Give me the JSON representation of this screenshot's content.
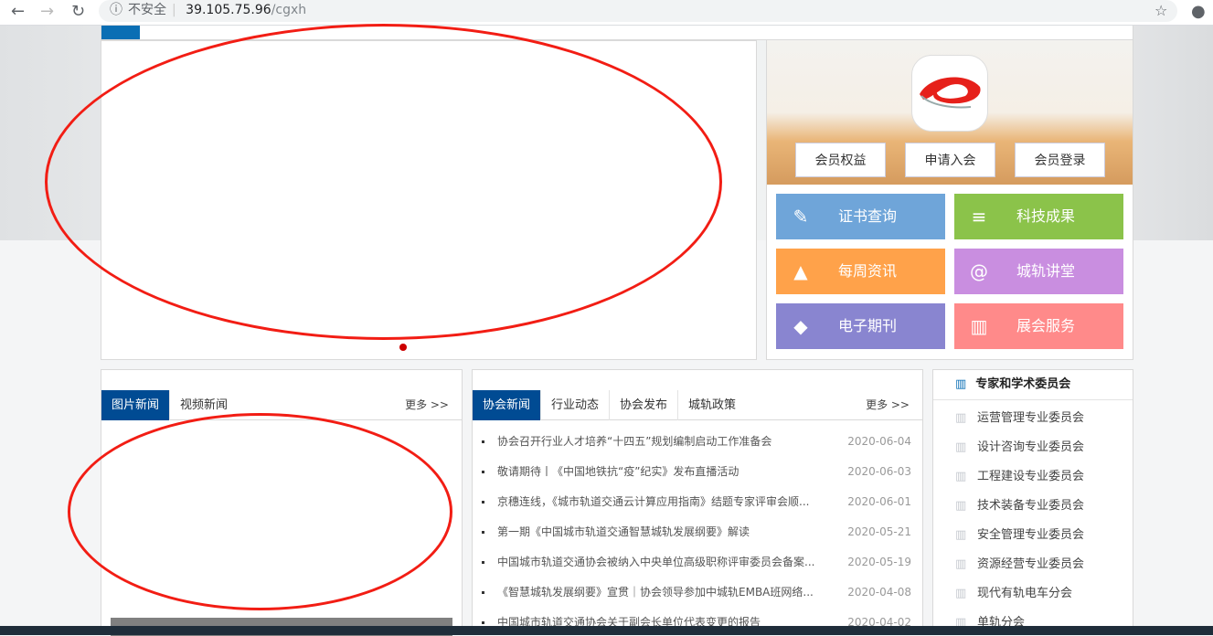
{
  "browser": {
    "back": "←",
    "forward": "→",
    "reload": "↻",
    "info": "ⓘ",
    "security": "不安全",
    "host": "39.105.75.96",
    "path": "/cgxh",
    "star": "☆",
    "account": "●"
  },
  "member": {
    "buttons": [
      "会员权益",
      "申请入会",
      "会员登录"
    ]
  },
  "tiles": [
    {
      "label": "证书查询",
      "icon": "chat-icon",
      "glyph": "✎",
      "color": "#6fa5d9"
    },
    {
      "label": "科技成果",
      "icon": "book-icon",
      "glyph": "≡",
      "color": "#8bc34a"
    },
    {
      "label": "每周资讯",
      "icon": "chart-icon",
      "glyph": "▲",
      "color": "#ffa24a"
    },
    {
      "label": "城轨讲堂",
      "icon": "contacts-icon",
      "glyph": "@",
      "color": "#c98ee0"
    },
    {
      "label": "电子期刊",
      "icon": "diamond-icon",
      "glyph": "◆",
      "color": "#8985d0"
    },
    {
      "label": "展会服务",
      "icon": "building-icon",
      "glyph": "▥",
      "color": "#ff8a8a"
    }
  ],
  "photo": {
    "tabs": [
      "图片新闻",
      "视频新闻"
    ],
    "more": "更多 >>"
  },
  "news": {
    "tabs": [
      "协会新闻",
      "行业动态",
      "协会发布",
      "城轨政策"
    ],
    "more": "更多 >>",
    "items": [
      {
        "title": "协会召开行业人才培养“十四五”规划编制启动工作准备会",
        "date": "2020-06-04"
      },
      {
        "title": "敬请期待丨《中国地铁抗“疫”纪实》发布直播活动",
        "date": "2020-06-03"
      },
      {
        "title": "京穗连线，《城市轨道交通云计算应用指南》结题专家评审会顺...",
        "date": "2020-06-01"
      },
      {
        "title": "第一期《中国城市轨道交通智慧城轨发展纲要》解读",
        "date": "2020-05-21"
      },
      {
        "title": "中国城市轨道交通协会被纳入中央单位高级职称评审委员会备案...",
        "date": "2020-05-19"
      },
      {
        "title": "《智慧城轨发展纲要》宣贯｜协会领导参加中城轨EMBA班网络...",
        "date": "2020-04-08"
      },
      {
        "title": "中国城市轨道交通协会关于副会长单位代表变更的报告",
        "date": "2020-04-02"
      }
    ]
  },
  "committees": {
    "title": "专家和学术委员会",
    "items": [
      "运营管理专业委员会",
      "设计咨询专业委员会",
      "工程建设专业委员会",
      "技术装备专业委员会",
      "安全管理专业委员会",
      "资源经营专业委员会",
      "现代有轨电车分会",
      "单轨分会"
    ]
  }
}
